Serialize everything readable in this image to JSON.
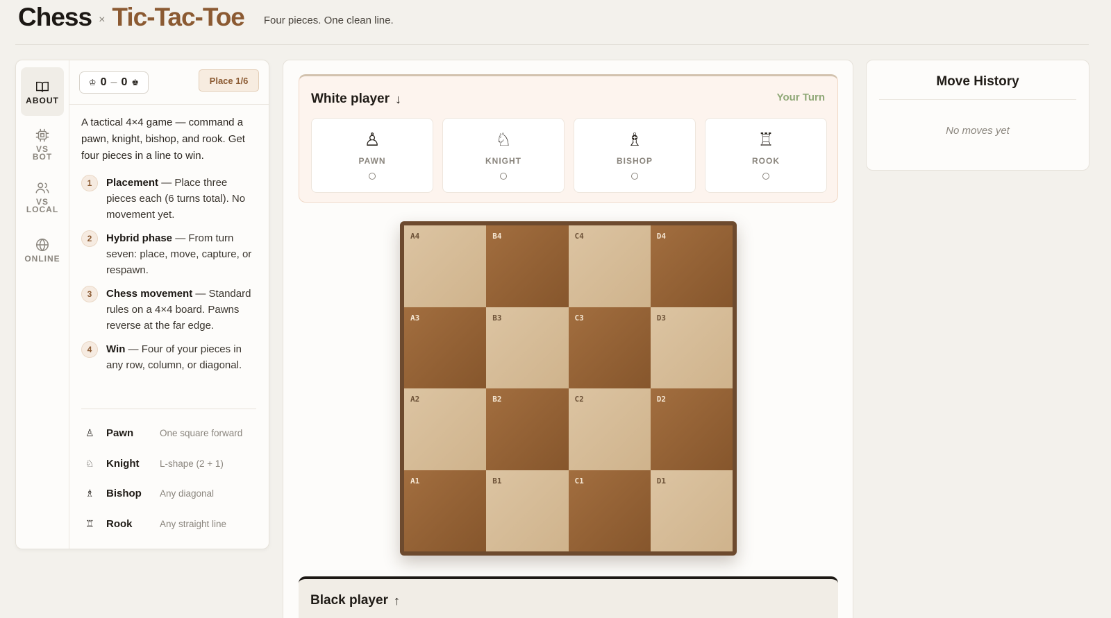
{
  "header": {
    "title_left": "Chess",
    "title_sep": "×",
    "title_right": "Tic-Tac-Toe",
    "tagline": "Four pieces. One clean line."
  },
  "rail": [
    {
      "label": "ABOUT",
      "icon": "book-icon",
      "active": true
    },
    {
      "label": "VS\nBOT",
      "icon": "chip-icon",
      "active": false
    },
    {
      "label": "VS\nLOCAL",
      "icon": "users-icon",
      "active": false
    },
    {
      "label": "ONLINE",
      "icon": "globe-icon",
      "active": false
    }
  ],
  "score": {
    "white_icon": "♔",
    "white": "0",
    "sep": "–",
    "black": "0",
    "black_icon": "♚"
  },
  "phase_badge": "Place 1/6",
  "about": {
    "intro": "A tactical 4×4 game — command a pawn, knight, bishop, and rook. Get four pieces in a line to win.",
    "rules": [
      {
        "num": "1",
        "title": "Placement",
        "text": " — Place three pieces each (6 turns total). No movement yet."
      },
      {
        "num": "2",
        "title": "Hybrid phase",
        "text": " — From turn seven: place, move, capture, or respawn."
      },
      {
        "num": "3",
        "title": "Chess movement",
        "text": " — Standard rules on a 4×4 board. Pawns reverse at the far edge."
      },
      {
        "num": "4",
        "title": "Win",
        "text": " — Four of your pieces in any row, column, or diagonal."
      }
    ],
    "pieces": [
      {
        "icon": "♙",
        "name": "Pawn",
        "desc": "One square forward"
      },
      {
        "icon": "♘",
        "name": "Knight",
        "desc": "L-shape (2 + 1)"
      },
      {
        "icon": "♗",
        "name": "Bishop",
        "desc": "Any diagonal"
      },
      {
        "icon": "♖",
        "name": "Rook",
        "desc": "Any straight line"
      }
    ]
  },
  "white_player": {
    "name": "White player",
    "arrow": "↓",
    "status": "Your Turn",
    "slots": [
      {
        "symbol": "♙",
        "label": "PAWN"
      },
      {
        "symbol": "♘",
        "label": "KNIGHT"
      },
      {
        "symbol": "♗",
        "label": "BISHOP"
      },
      {
        "symbol": "♖",
        "label": "ROOK"
      }
    ]
  },
  "board": {
    "rows": [
      [
        "A4",
        "B4",
        "C4",
        "D4"
      ],
      [
        "A3",
        "B3",
        "C3",
        "D3"
      ],
      [
        "A2",
        "B2",
        "C2",
        "D2"
      ],
      [
        "A1",
        "B1",
        "C1",
        "D1"
      ]
    ],
    "colors": {
      "light": "#dcc4a2",
      "dark": "#a26e3f",
      "frame": "#6d4a2e"
    }
  },
  "black_player": {
    "name": "Black player",
    "arrow": "↑"
  },
  "move_history": {
    "title": "Move History",
    "empty": "No moves yet"
  },
  "colors": {
    "accent": "#8b5a32",
    "turn": "#8fa877",
    "background": "#f3f1ec"
  }
}
